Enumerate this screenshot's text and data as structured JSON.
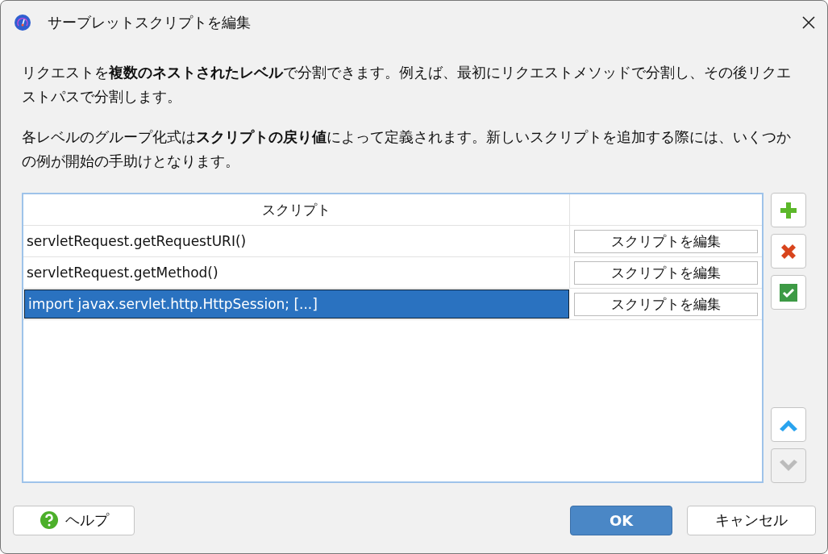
{
  "window": {
    "title": "サーブレットスクリプトを編集"
  },
  "paragraphs": [
    "リクエストを**複数のネストされたレベル**で分割できます。例えば、最初にリクエストメソッドで分割し、その後リクエストパスで分割します。",
    "各レベルのグループ化式は**スクリプトの戻り値**によって定義されます。新しいスクリプトを追加する際には、いくつかの例が開始の手助けとなります。"
  ],
  "table": {
    "columns": [
      "スクリプト"
    ],
    "rows": [
      {
        "script": "servletRequest.getRequestURI()",
        "button": "スクリプトを編集",
        "selected": false
      },
      {
        "script": "servletRequest.getMethod()",
        "button": "スクリプトを編集",
        "selected": false
      },
      {
        "script": "import javax.servlet.http.HttpSession; [...]",
        "button": "スクリプトを編集",
        "selected": true
      }
    ]
  },
  "side_buttons": [
    {
      "kind": "add",
      "disabled": false
    },
    {
      "kind": "delete",
      "disabled": false
    },
    {
      "kind": "check",
      "disabled": false
    },
    {
      "kind": "up",
      "disabled": false
    },
    {
      "kind": "down",
      "disabled": true
    }
  ],
  "buttons": {
    "help": "ヘルプ",
    "ok": "OK",
    "cancel": "キャンセル"
  }
}
